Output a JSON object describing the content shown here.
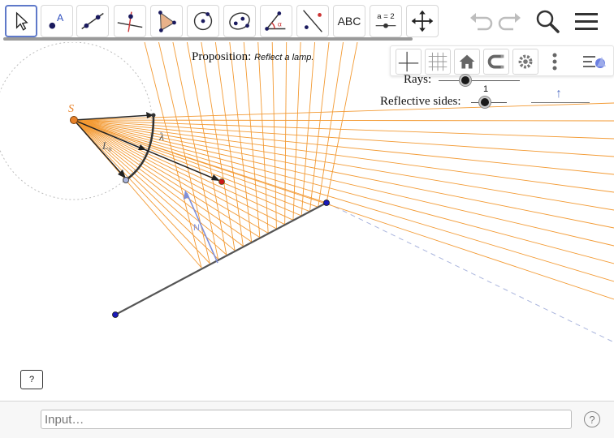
{
  "toolbar": {
    "tools": [
      {
        "name": "move-tool",
        "icon": "cursor-arrow-icon",
        "active": true
      },
      {
        "name": "point-tool",
        "icon": "point-A-icon"
      },
      {
        "name": "line-tool",
        "icon": "line-through-points-icon"
      },
      {
        "name": "perpendicular-line-tool",
        "icon": "perpendicular-line-icon"
      },
      {
        "name": "polygon-tool",
        "icon": "polygon-icon"
      },
      {
        "name": "circle-tool",
        "icon": "circle-center-point-icon"
      },
      {
        "name": "conic-tool",
        "icon": "ellipse-icon"
      },
      {
        "name": "angle-tool",
        "icon": "angle-icon"
      },
      {
        "name": "reflect-tool",
        "icon": "reflect-about-line-icon"
      },
      {
        "name": "text-tool",
        "icon": "text-icon",
        "label": "ABC"
      },
      {
        "name": "slider-tool",
        "icon": "slider-icon",
        "label": "a = 2"
      },
      {
        "name": "move-graphics-tool",
        "icon": "move-graphics-view-icon"
      }
    ],
    "undo_icon": "undo-icon",
    "redo_icon": "redo-icon",
    "search_icon": "search-icon",
    "menu_icon": "menu-icon"
  },
  "style_bar": {
    "buttons": [
      "axes-icon",
      "grid-icon",
      "home-icon",
      "magnet-icon",
      "gear-icon",
      "more-vertical-icon",
      "style-bar-toggle-icon"
    ]
  },
  "graphics": {
    "proposition_label": "Proposition:",
    "proposition_value": "Reflect a lamp.",
    "rays_label": "Rays:",
    "reflective_sides_label": "Reflective sides:",
    "reflective_sides_value": "1",
    "arrow_glyph": "↑",
    "point_S": "S",
    "label_L0": "L₀",
    "label_lambda": "λ",
    "label_N": "N",
    "colors": {
      "ray": "#f39a33",
      "segment": "#555555",
      "point_blue": "#1a1ab8",
      "point_red": "#cc1a1a",
      "source": "#e8822a",
      "normal": "#7f8fd9"
    }
  },
  "help_button": "?",
  "input_bar": {
    "placeholder": "Input…",
    "help_glyph": "?"
  }
}
